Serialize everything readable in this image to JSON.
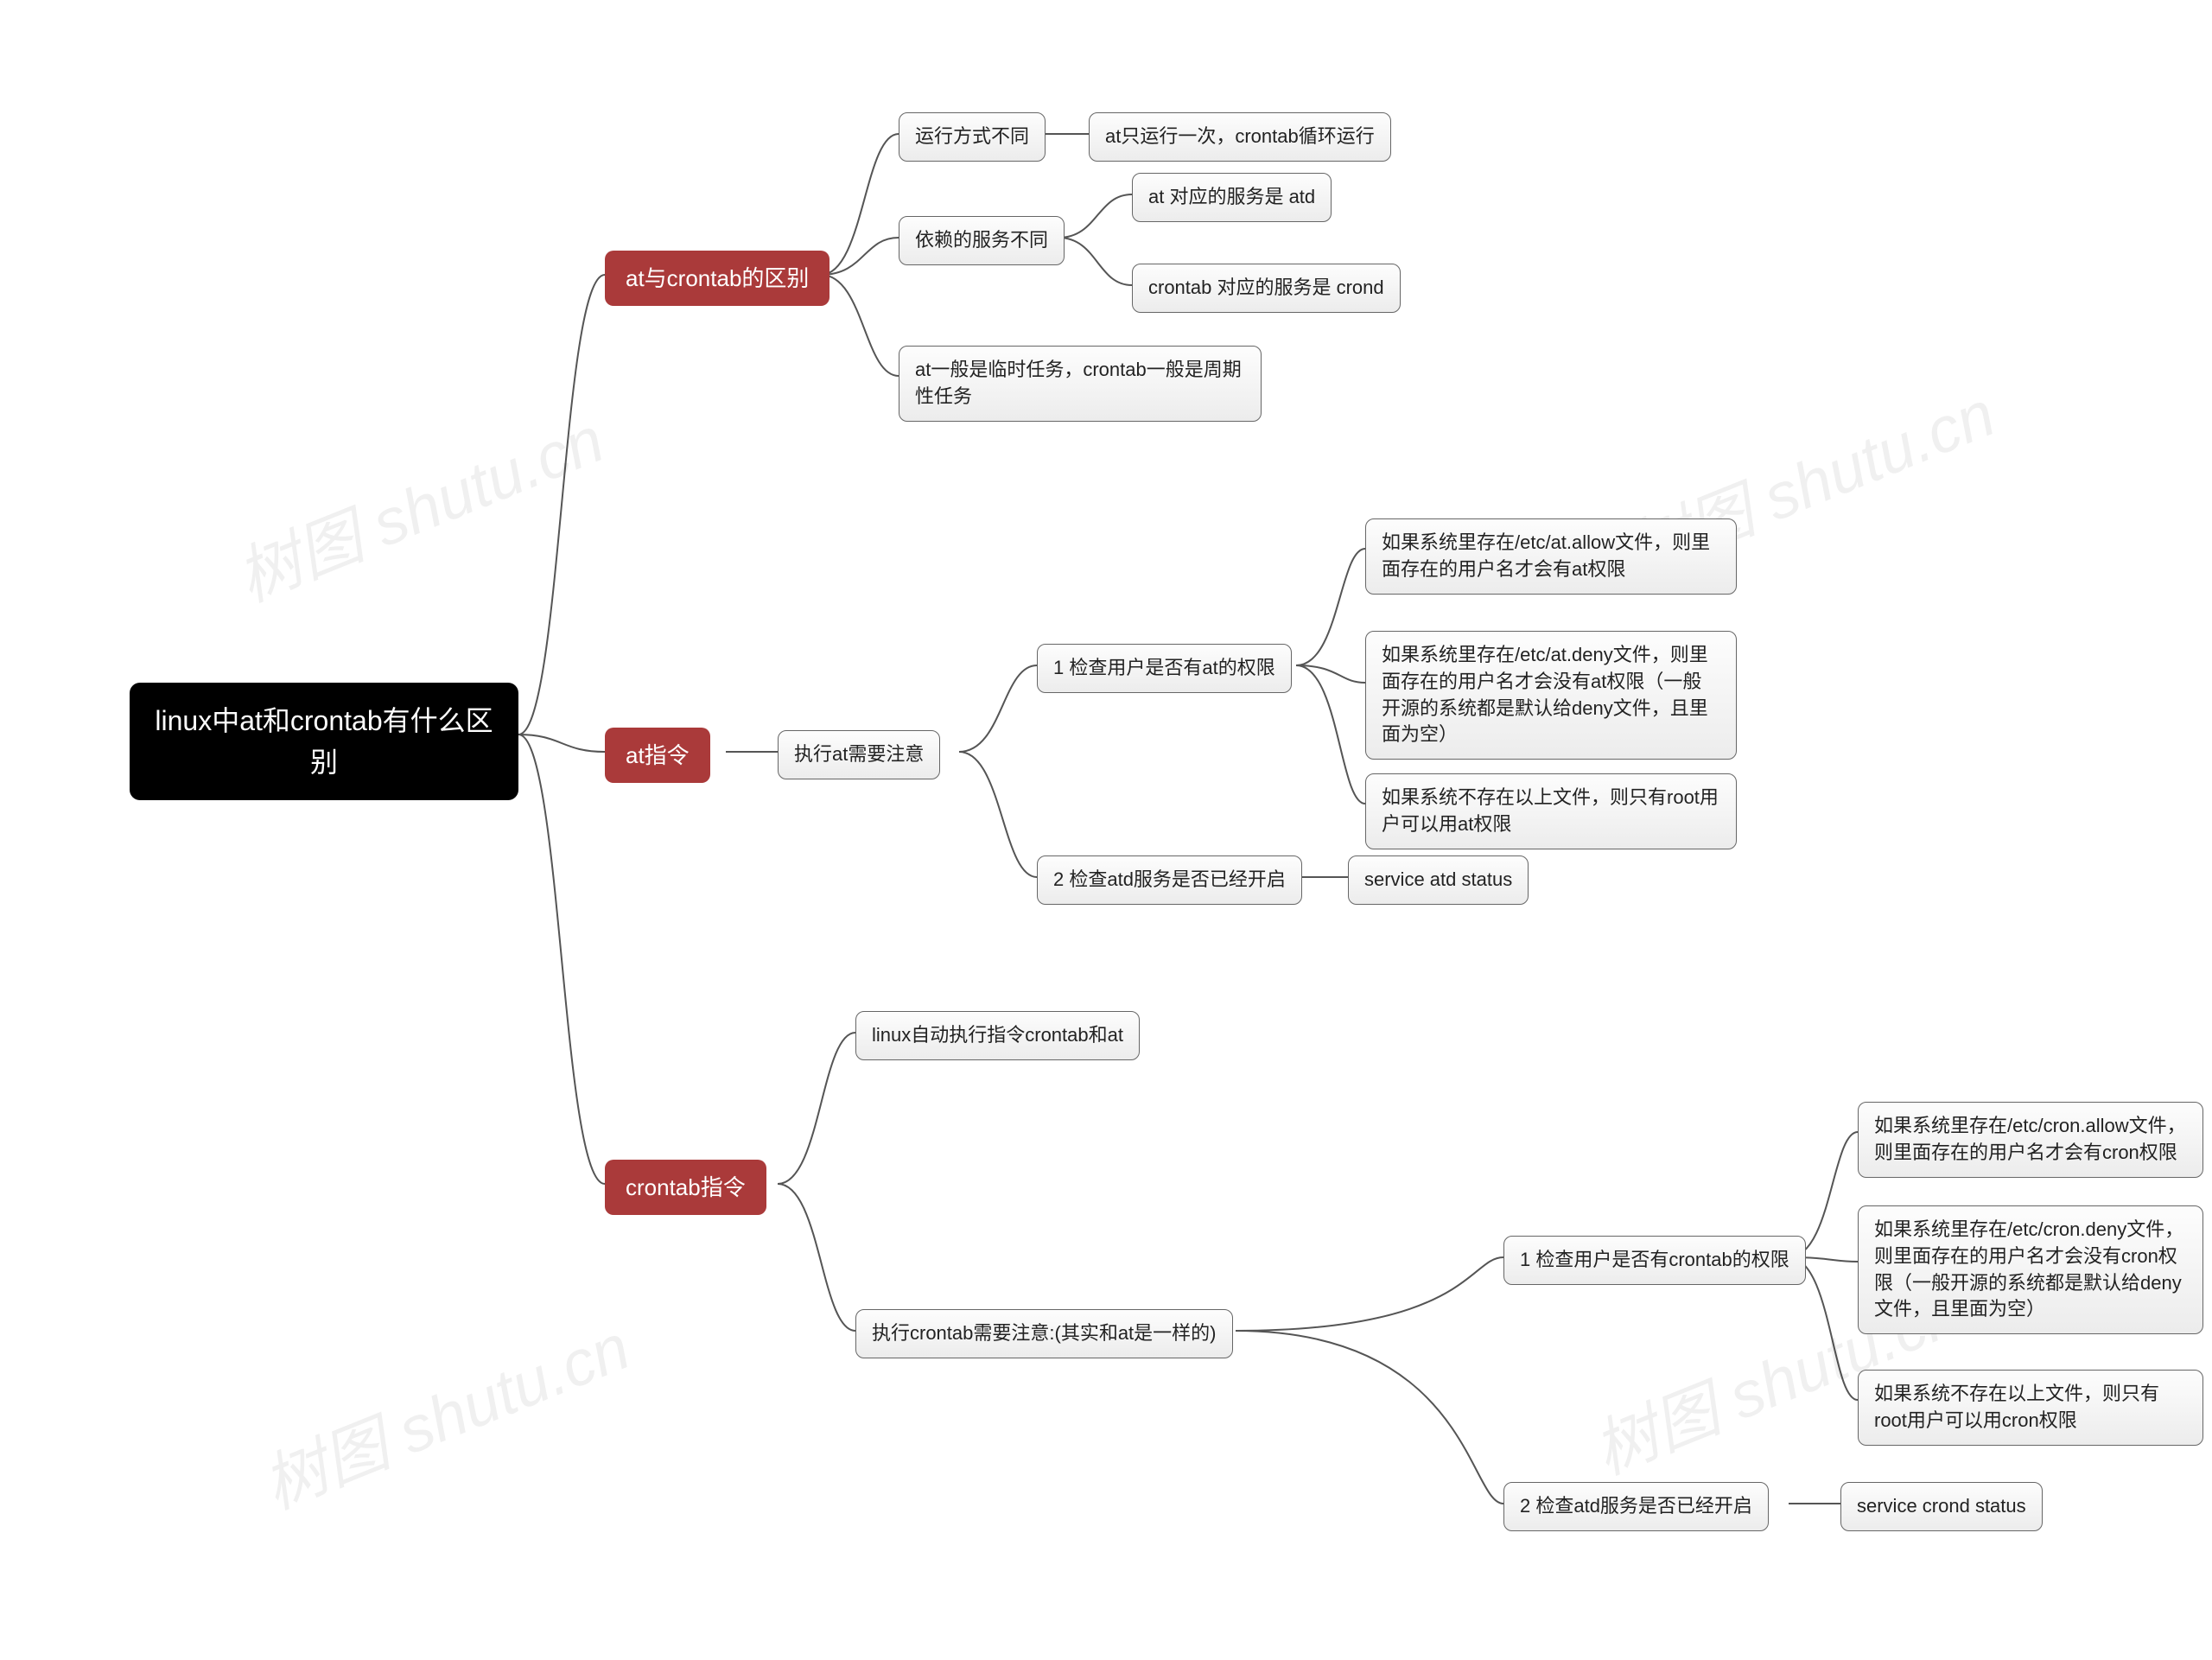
{
  "root": "linux中at和crontab有什么区别",
  "branches": {
    "diff": "at与crontab的区别",
    "at": "at指令",
    "cron": "crontab指令"
  },
  "diff": {
    "run_mode": "运行方式不同",
    "run_mode_detail": "at只运行一次，crontab循环运行",
    "service": "依赖的服务不同",
    "service_at": "at 对应的服务是 atd",
    "service_cron": "crontab 对应的服务是 crond",
    "temp_vs_periodic": "at一般是临时任务，crontab一般是周期性任务"
  },
  "at": {
    "notes": "执行at需要注意",
    "check_perm": "1 检查用户是否有at的权限",
    "perm_allow": "如果系统里存在/etc/at.allow文件，则里面存在的用户名才会有at权限",
    "perm_deny": "如果系统里存在/etc/at.deny文件，则里面存在的用户名才会没有at权限（一般开源的系统都是默认给deny文件，且里面为空）",
    "perm_root": "如果系统不存在以上文件，则只有root用户可以用at权限",
    "check_service": "2 检查atd服务是否已经开启",
    "service_cmd": "service atd status"
  },
  "cron": {
    "auto": "linux自动执行指令crontab和at",
    "notes": "执行crontab需要注意:(其实和at是一样的)",
    "check_perm": "1 检查用户是否有crontab的权限",
    "perm_allow": "如果系统里存在/etc/cron.allow文件，则里面存在的用户名才会有cron权限",
    "perm_deny": "如果系统里存在/etc/cron.deny文件，则里面存在的用户名才会没有cron权限（一般开源的系统都是默认给deny文件，且里面为空）",
    "perm_root": "如果系统不存在以上文件，则只有root用户可以用cron权限",
    "check_service": "2 检查atd服务是否已经开启",
    "service_cmd": "service crond status"
  },
  "watermark": "树图 shutu.cn"
}
